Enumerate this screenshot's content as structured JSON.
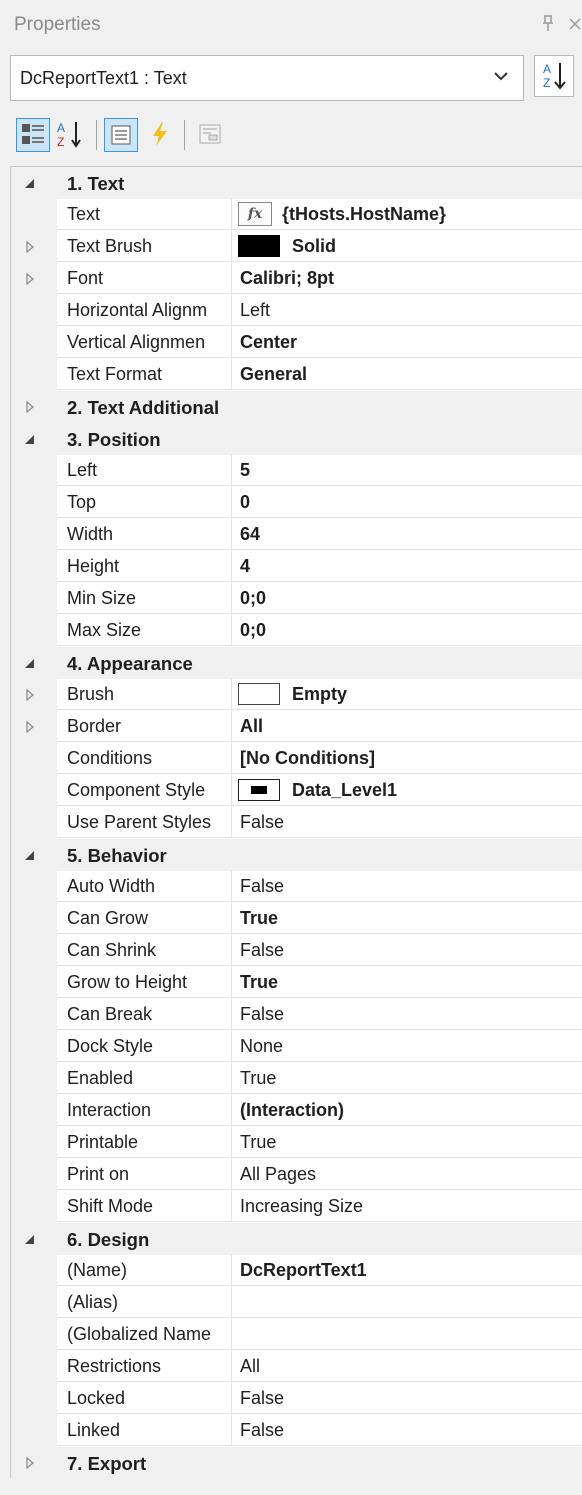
{
  "panel": {
    "title": "Properties",
    "pin_icon": "pin-icon",
    "close_icon": "close-icon"
  },
  "object_selector": {
    "value": "DcReportText1 : Text"
  },
  "toolbar": {
    "buttons": [
      "categorized-icon",
      "alphabetical-icon",
      "properties-icon",
      "events-icon",
      "property-pages-icon"
    ]
  },
  "colors": {
    "accent": "#3c96dc",
    "active_bg": "#cce4f7",
    "events_yellow": "#f0c020"
  },
  "categories": [
    {
      "label": "1. Text",
      "expanded": true,
      "props": [
        {
          "name": "Text",
          "value": "{tHosts.HostName}",
          "bold": true,
          "editor": "fx",
          "expandable": false
        },
        {
          "name": "Text Brush",
          "value": "Solid",
          "bold": true,
          "editor": "black",
          "expandable": true
        },
        {
          "name": "Font",
          "value": "Calibri; 8pt",
          "bold": true,
          "expandable": true
        },
        {
          "name": "Horizontal Alignm",
          "value": "Left",
          "bold": false,
          "expandable": false
        },
        {
          "name": "Vertical Alignmen",
          "value": "Center",
          "bold": true,
          "expandable": false
        },
        {
          "name": "Text Format",
          "value": "General",
          "bold": true,
          "expandable": false
        }
      ]
    },
    {
      "label": "2. Text  Additional",
      "expanded": false,
      "props": []
    },
    {
      "label": "3. Position",
      "expanded": true,
      "props": [
        {
          "name": "Left",
          "value": "5",
          "bold": true
        },
        {
          "name": "Top",
          "value": "0",
          "bold": true
        },
        {
          "name": "Width",
          "value": "64",
          "bold": true
        },
        {
          "name": "Height",
          "value": "4",
          "bold": true
        },
        {
          "name": "Min Size",
          "value": "0;0",
          "bold": true
        },
        {
          "name": "Max Size",
          "value": "0;0",
          "bold": true
        }
      ]
    },
    {
      "label": "4. Appearance",
      "expanded": true,
      "props": [
        {
          "name": "Brush",
          "value": "Empty",
          "bold": true,
          "editor": "white",
          "expandable": true
        },
        {
          "name": "Border",
          "value": "All",
          "bold": true,
          "expandable": true
        },
        {
          "name": "Conditions",
          "value": "[No Conditions]",
          "bold": true
        },
        {
          "name": "Component Style",
          "value": "Data_Level1",
          "bold": true,
          "editor": "style"
        },
        {
          "name": "Use Parent Styles",
          "value": "False",
          "bold": false
        }
      ]
    },
    {
      "label": "5. Behavior",
      "expanded": true,
      "props": [
        {
          "name": "Auto Width",
          "value": "False",
          "bold": false
        },
        {
          "name": "Can Grow",
          "value": "True",
          "bold": true
        },
        {
          "name": "Can Shrink",
          "value": "False",
          "bold": false
        },
        {
          "name": "Grow to Height",
          "value": "True",
          "bold": true
        },
        {
          "name": "Can Break",
          "value": "False",
          "bold": false
        },
        {
          "name": "Dock Style",
          "value": "None",
          "bold": false
        },
        {
          "name": "Enabled",
          "value": "True",
          "bold": false
        },
        {
          "name": "Interaction",
          "value": "(Interaction)",
          "bold": true
        },
        {
          "name": "Printable",
          "value": "True",
          "bold": false
        },
        {
          "name": "Print on",
          "value": "All Pages",
          "bold": false
        },
        {
          "name": "Shift Mode",
          "value": "Increasing Size",
          "bold": false
        }
      ]
    },
    {
      "label": "6. Design",
      "expanded": true,
      "props": [
        {
          "name": "(Name)",
          "value": "DcReportText1",
          "bold": true
        },
        {
          "name": "(Alias)",
          "value": "",
          "bold": false
        },
        {
          "name": "(Globalized Name",
          "value": "",
          "bold": false
        },
        {
          "name": "Restrictions",
          "value": "All",
          "bold": false
        },
        {
          "name": "Locked",
          "value": "False",
          "bold": false
        },
        {
          "name": "Linked",
          "value": "False",
          "bold": false
        }
      ]
    },
    {
      "label": "7. Export",
      "expanded": false,
      "props": []
    }
  ]
}
